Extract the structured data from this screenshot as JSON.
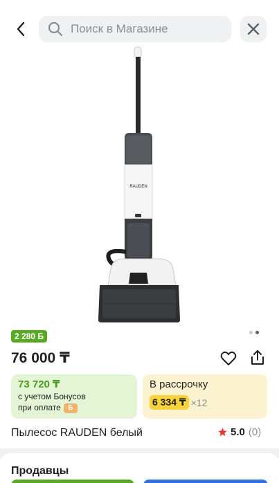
{
  "header": {
    "search_placeholder": "Поиск в Магазине"
  },
  "product": {
    "image_alt": "Пылесос RAUDEN белый",
    "brand_on_device": "RAUDEN",
    "bonus_badge": "2 280 Б",
    "price": "76 000 ₸",
    "name": "Пылесос RAUDEN белый",
    "rating": "5.0",
    "reviews_count": "(0)",
    "gallery_dots": 2
  },
  "bonus_card": {
    "amount": "73 720 ₸",
    "line1": "с учетом Бонусов",
    "line2": "при оплате",
    "badge": "Б"
  },
  "installment_card": {
    "title": "В рассрочку",
    "amount": "6 334 ₸",
    "multiplier": "×12"
  },
  "sellers": {
    "title": "Продавцы"
  },
  "colors": {
    "accent_green": "#5aa925",
    "bonus_card_bg": "#e4f5d6",
    "installment_card_bg": "#fbf3cf",
    "installment_highlight": "#f7d23a",
    "rating_star": "#e53935",
    "sellers_blue_button": "#2f6fe0"
  }
}
